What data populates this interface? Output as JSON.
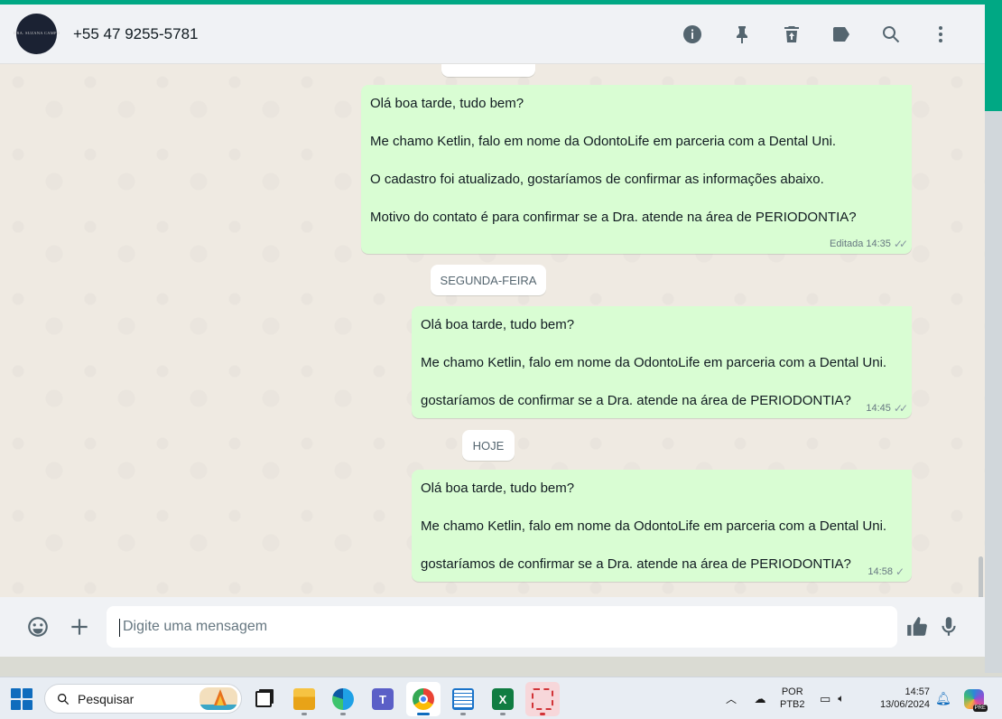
{
  "header": {
    "contact_name": "+55 47 9255-5781",
    "avatar_text": "DRA. SUZANA CAMPO",
    "icons": [
      "info-icon",
      "pin-icon",
      "delete-icon",
      "label-icon",
      "search-icon",
      "menu-icon"
    ]
  },
  "chat": {
    "messages": [
      {
        "lines": [
          "Olá boa tarde, tudo bem?",
          "Me chamo Ketlin, falo em nome da OdontoLife em parceria com a Dental Uni.",
          "O cadastro foi atualizado, gostaríamos de confirmar as informações abaixo.",
          "Motivo do contato é para confirmar se a Dra. atende na área de PERIODONTIA?"
        ],
        "edited_label": "Editada",
        "time": "14:35",
        "status": "read"
      },
      {
        "lines": [
          "Olá boa tarde, tudo bem?",
          "Me chamo Ketlin, falo em nome da OdontoLife em parceria com a Dental Uni.",
          "gostaríamos de confirmar se a Dra. atende na área de PERIODONTIA?"
        ],
        "time": "14:45",
        "status": "read"
      },
      {
        "lines": [
          "Olá boa tarde, tudo bem?",
          "Me chamo Ketlin, falo em nome da OdontoLife em parceria com a Dental Uni.",
          "gostaríamos de confirmar se a Dra. atende na área de PERIODONTIA?"
        ],
        "time": "14:58",
        "status": "sent"
      }
    ],
    "date_chips": [
      "SEGUNDA-FEIRA",
      "HOJE"
    ]
  },
  "composer": {
    "placeholder": "Digite uma mensagem",
    "icons": [
      "emoji-icon",
      "plus-icon",
      "thumbs-up-icon",
      "microphone-icon"
    ]
  },
  "taskbar": {
    "search_label": "Pesquisar",
    "apps": [
      "task-view",
      "file-explorer",
      "edge",
      "teams",
      "chrome",
      "notepad",
      "excel",
      "snipping-tool"
    ],
    "language": [
      "POR",
      "PTB2"
    ],
    "time": "14:57",
    "date": "13/06/2024",
    "copilot_badge": "PRE"
  },
  "colors": {
    "accent": "#00a884",
    "outgoing_bubble": "#d9fdd3",
    "chat_background": "#efeae2"
  }
}
